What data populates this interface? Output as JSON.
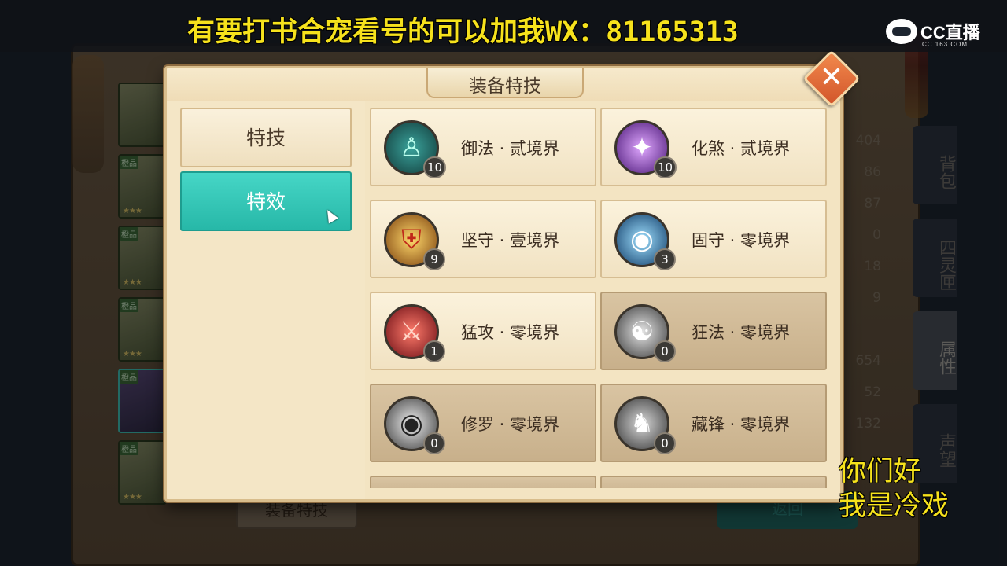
{
  "stream": {
    "banner_text": "有要打书合宠看号的可以加我WX：81165313",
    "platform_name": "CC直播",
    "platform_url": "CC.163.COM",
    "greeting_line1": "你们好",
    "greeting_line2": "我是冷戏"
  },
  "background": {
    "slot_tag": "橙品",
    "stats": [
      "404",
      "86",
      "87",
      "0",
      "18",
      "9",
      "",
      "654",
      "52",
      "132"
    ],
    "side_tabs": [
      "背包",
      "四灵匣",
      "属性",
      "声望"
    ],
    "active_tab": "属性",
    "equip_button": "装备特技",
    "back_button": "返回"
  },
  "modal": {
    "title": "装备特技",
    "close_label": "✕",
    "left_tabs": [
      {
        "label": "特技",
        "active": false
      },
      {
        "label": "特效",
        "active": true
      }
    ],
    "skills": [
      {
        "name": "御法 · 贰境界",
        "level": "10",
        "icon": "figure-rune-icon",
        "glyph": "♙",
        "color": "#1e5d5c",
        "locked": false
      },
      {
        "name": "化煞 · 贰境界",
        "level": "10",
        "icon": "purple-vortex-icon",
        "glyph": "✦",
        "color": "#6b2fa3",
        "locked": false
      },
      {
        "name": "坚守 · 壹境界",
        "level": "9",
        "icon": "golden-shield-icon",
        "glyph": "⛨",
        "color": "#b0741b",
        "locked": false
      },
      {
        "name": "固守 · 零境界",
        "level": "3",
        "icon": "blue-eye-icon",
        "glyph": "◉",
        "color": "#1d5a8c",
        "locked": false
      },
      {
        "name": "猛攻 · 零境界",
        "level": "1",
        "icon": "crossed-swords-icon",
        "glyph": "⚔",
        "color": "#a61f26",
        "locked": false
      },
      {
        "name": "狂法 · 零境界",
        "level": "0",
        "icon": "grey-dragon-icon",
        "glyph": "☯",
        "color": "#6a6a6a",
        "locked": true
      },
      {
        "name": "修罗 · 零境界",
        "level": "0",
        "icon": "grey-eye-icon",
        "glyph": "◉",
        "color": "#6a6a6a",
        "locked": true
      },
      {
        "name": "藏锋 · 零境界",
        "level": "0",
        "icon": "grey-runner-icon",
        "glyph": "♞",
        "color": "#6a6a6a",
        "locked": true
      }
    ]
  }
}
